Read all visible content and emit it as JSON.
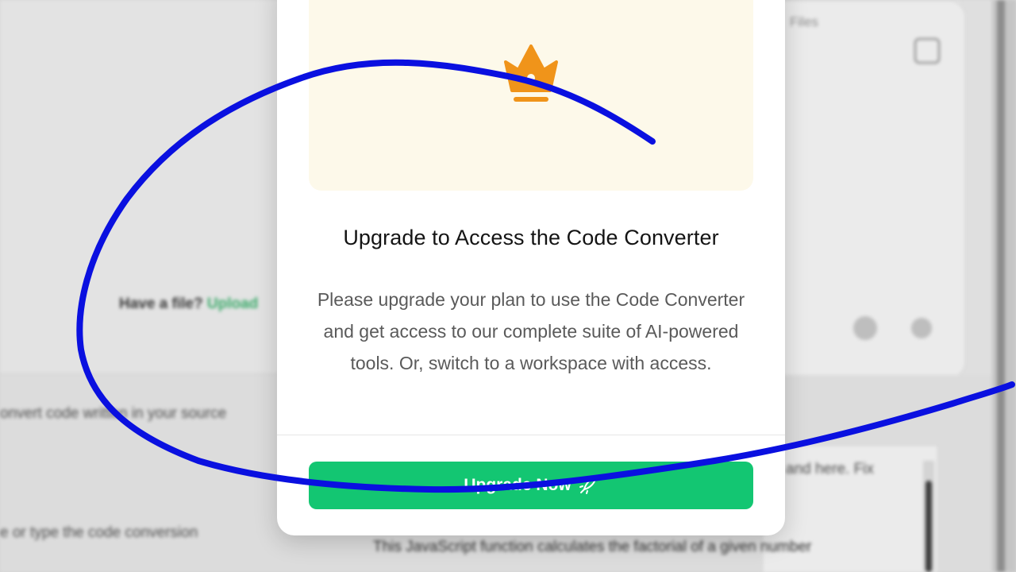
{
  "background": {
    "snippet_left": "Have a file?",
    "snippet_left_accent": "Upload",
    "snippet_mid": "onvert code written in your source",
    "snippet_lower": "e or type the code conversion",
    "snippet_right_top": "Files",
    "snippet_right_mid": "and here. Fix",
    "snippet_bottom": "This JavaScript function calculates the factorial of a given number"
  },
  "modal": {
    "title": "Upgrade to Access the Code Converter",
    "body": "Please upgrade your plan to use the Code Converter and get access to our complete suite of AI-powered tools. Or, switch to a workspace with access.",
    "button_label": "Upgrade Now",
    "hero_icon": "crown-icon",
    "button_icon": "rocket-icon"
  },
  "colors": {
    "hero_background": "#fdf9ea",
    "crown": "#f0941a",
    "primary_button": "#13c672",
    "annotation_stroke": "#0a10e0"
  }
}
